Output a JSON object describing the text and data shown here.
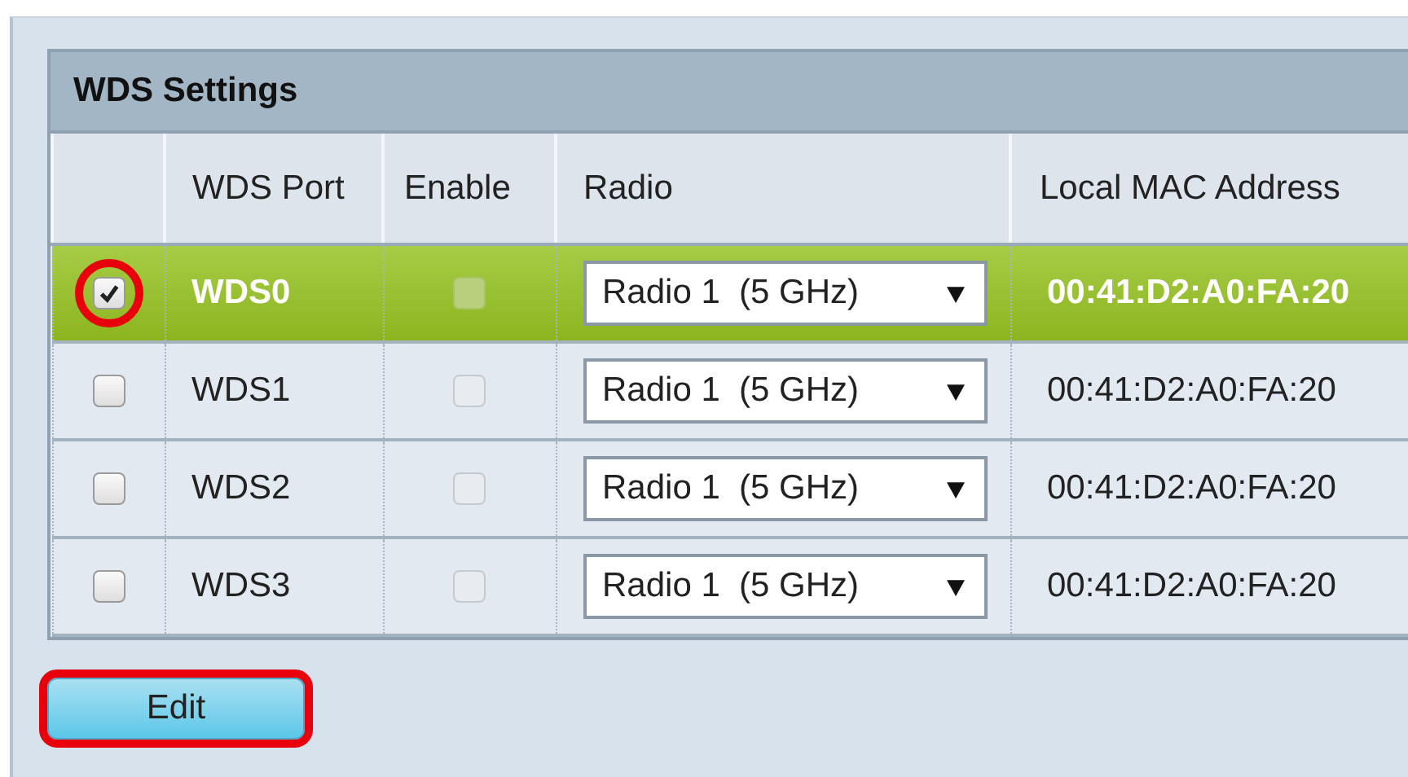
{
  "panel": {
    "title": "WDS Settings"
  },
  "table": {
    "columns": [
      "",
      "WDS Port",
      "Enable",
      "Radio",
      "Local MAC Address"
    ],
    "rows": [
      {
        "selected": true,
        "checked": true,
        "highlighted": true,
        "port": "WDS0",
        "enable": false,
        "radio": "Radio 1  (5 GHz)",
        "mac": "00:41:D2:A0:FA:20"
      },
      {
        "selected": false,
        "checked": false,
        "highlighted": false,
        "port": "WDS1",
        "enable": false,
        "radio": "Radio 1  (5 GHz)",
        "mac": "00:41:D2:A0:FA:20"
      },
      {
        "selected": false,
        "checked": false,
        "highlighted": false,
        "port": "WDS2",
        "enable": false,
        "radio": "Radio 1  (5 GHz)",
        "mac": "00:41:D2:A0:FA:20"
      },
      {
        "selected": false,
        "checked": false,
        "highlighted": false,
        "port": "WDS3",
        "enable": false,
        "radio": "Radio 1  (5 GHz)",
        "mac": "00:41:D2:A0:FA:20"
      }
    ]
  },
  "buttons": [
    {
      "label": "Edit",
      "highlighted": true
    }
  ]
}
